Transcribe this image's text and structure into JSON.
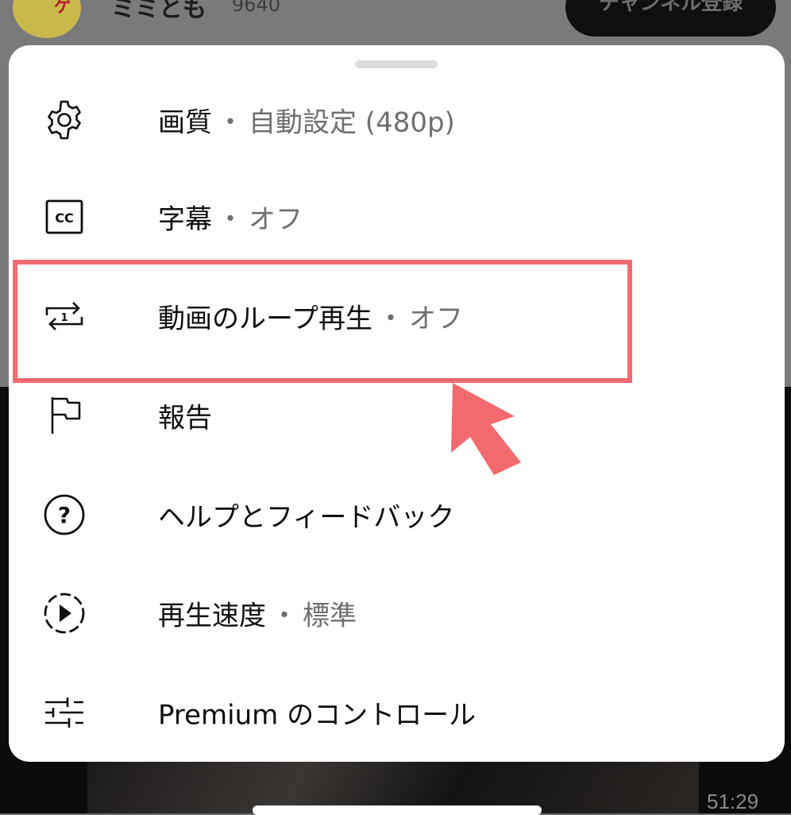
{
  "background": {
    "channel_name": "ミミとも",
    "subscriber_count": "9640",
    "subscribe_label": "チャンネル登録",
    "video_duration": "51:29"
  },
  "menu": {
    "items": [
      {
        "label": "画質",
        "separator": "・",
        "value": "自動設定 (480p)",
        "icon": "gear-icon"
      },
      {
        "label": "字幕",
        "separator": "・",
        "value": "オフ",
        "icon": "closed-captions-icon"
      },
      {
        "label": "動画のループ再生",
        "separator": "・",
        "value": "オフ",
        "icon": "loop-one-icon"
      },
      {
        "label": "報告",
        "icon": "flag-icon"
      },
      {
        "label": "ヘルプとフィードバック",
        "icon": "help-circle-icon"
      },
      {
        "label": "再生速度",
        "separator": "・",
        "value": "標準",
        "icon": "playback-speed-icon"
      },
      {
        "label": "Premium のコントロール",
        "icon": "sliders-icon"
      }
    ]
  },
  "annotation": {
    "highlight_color": "#f26a6e",
    "highlighted_item": "動画のループ再生"
  },
  "colors": {
    "sheet_bg": "#ffffff",
    "value_text": "#6f6f6f",
    "primary_text": "#0f0f0f"
  }
}
